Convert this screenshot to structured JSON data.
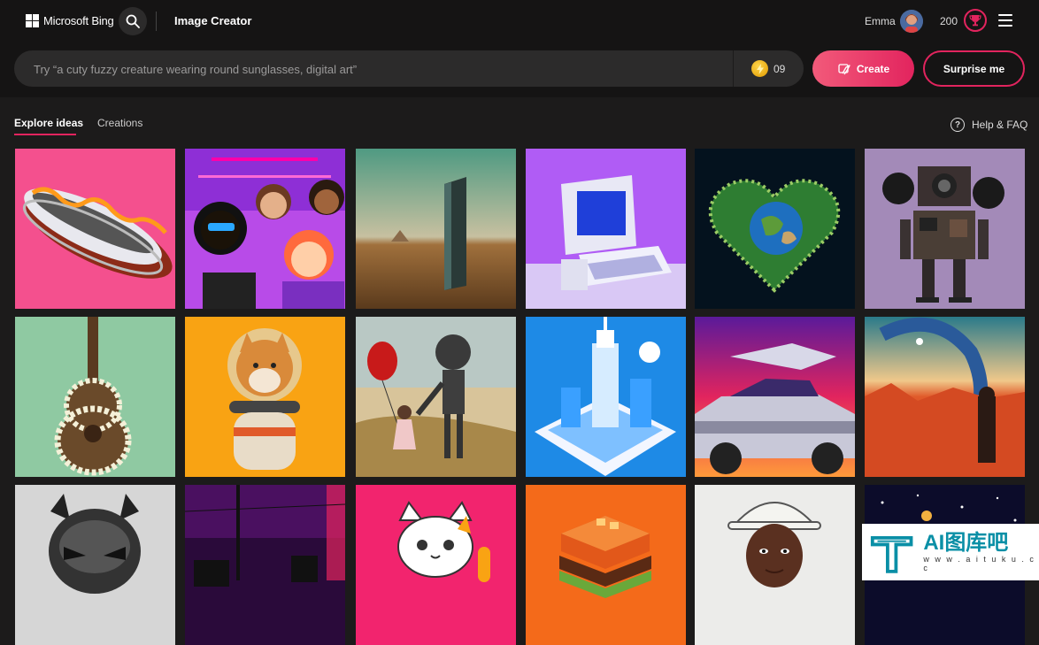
{
  "header": {
    "logo_text": "Microsoft Bing",
    "app_title": "Image Creator",
    "user_name": "Emma",
    "points": "200",
    "icons": [
      "search-icon",
      "rewards-trophy-icon",
      "hamburger-menu-icon"
    ]
  },
  "prompt": {
    "placeholder": "Try “a cuty fuzzy creature wearing round sunglasses, digital art”",
    "boosts": "09",
    "create_label": "Create",
    "surprise_label": "Surprise me"
  },
  "tabs": {
    "explore": "Explore ideas",
    "creations": "Creations"
  },
  "help": {
    "label": "Help & FAQ"
  },
  "colors": {
    "accent": "#e2245e",
    "background": "#1c1b1b",
    "header": "#151414"
  },
  "gallery": [
    "hot-dog-chrome",
    "friends-group",
    "monolith-desert",
    "retro-computer",
    "earth-heart",
    "steampunk-robot",
    "flower-guitar",
    "shiba-astronaut",
    "robot-girl-balloon",
    "isometric-city",
    "delorean-synthwave",
    "desert-figure",
    "chrome-helmet",
    "neon-street",
    "lucky-cat",
    "isometric-burger",
    "construction-woman",
    "space-night"
  ],
  "watermark": {
    "title": "AI图库吧",
    "url": "w w w . a i t u k u . c c"
  }
}
